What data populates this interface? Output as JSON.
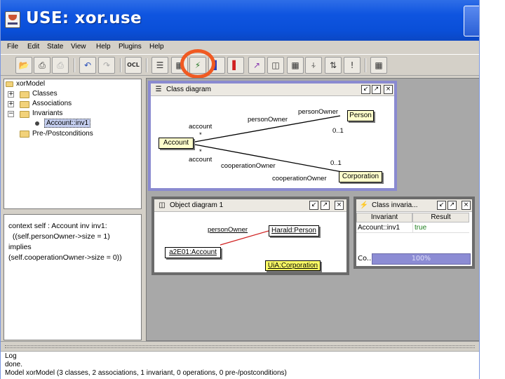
{
  "window": {
    "title": "USE: xor.use"
  },
  "menu": [
    "File",
    "Edit",
    "State",
    "View",
    "Help",
    "Plugins",
    "Help"
  ],
  "toolbar": {
    "ocl_label": "OCL"
  },
  "model_tree": {
    "root": "xorModel",
    "items": [
      {
        "label": "Classes"
      },
      {
        "label": "Associations"
      },
      {
        "label": "Invariants"
      },
      {
        "label": "Account::inv1"
      },
      {
        "label": "Pre-/Postconditions"
      }
    ]
  },
  "ocl_text": {
    "lines": [
      "context self : Account inv inv1:",
      "  ((self.personOwner->size = 1)",
      "implies",
      "(self.cooperationOwner->size = 0))"
    ]
  },
  "class_diagram": {
    "title": "Class diagram",
    "classes": [
      "Account",
      "Person",
      "Corporation"
    ],
    "assoc1": {
      "name": "personOwner",
      "role_left": "account",
      "role_right": "personOwner",
      "mult_left": "*",
      "mult_right": "0..1"
    },
    "assoc2": {
      "name": "cooperationOwner",
      "role_left": "account",
      "role_right": "cooperationOwner",
      "mult_left": "*",
      "mult_right": "0..1"
    }
  },
  "object_diagram": {
    "title": "Object diagram 1",
    "link_label": "personOwner",
    "objects": [
      "Harald:Person",
      "a2E01:Account",
      "UiA:Corporation"
    ]
  },
  "class_invariants": {
    "title": "Class invaria...",
    "columns": [
      "Invariant",
      "Result"
    ],
    "rows": [
      {
        "invariant": "Account::inv1",
        "result": "true"
      }
    ],
    "status_label": "Co...",
    "progress_text": "100%"
  },
  "log": {
    "header": "Log",
    "lines": [
      "done.",
      "Model xorModel (3 classes, 2 associations, 1 invariant, 0 operations, 0 pre-/postconditions)"
    ]
  },
  "colors": {
    "titlebar": "#0a4fd8",
    "highlight_ring": "#f05a22",
    "class_box_fill": "#ffffcc",
    "link_red": "#d02020",
    "result_true": "#208020",
    "progress": "#8c8cd4"
  }
}
